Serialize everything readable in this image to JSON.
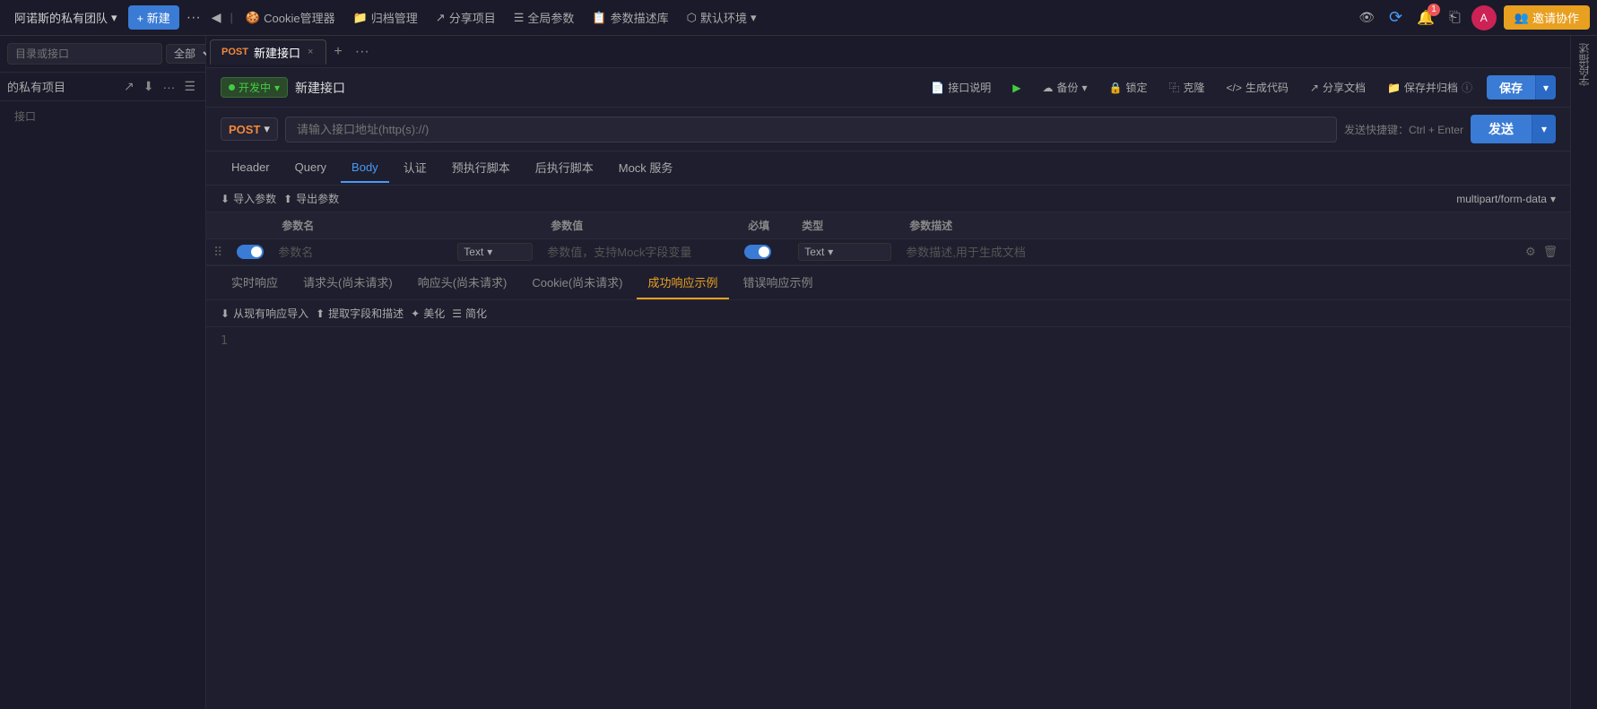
{
  "topNav": {
    "teamName": "阿诺斯的私有团队",
    "newBtn": "+ 新建",
    "moreBtn": "···",
    "prevBtn": "‹",
    "items": [
      {
        "label": "Cookie管理器",
        "icon": "cookie-icon"
      },
      {
        "label": "归档管理",
        "icon": "archive-icon"
      },
      {
        "label": "分享项目",
        "icon": "share-icon"
      },
      {
        "label": "全局参数",
        "icon": "global-param-icon"
      },
      {
        "label": "参数描述库",
        "icon": "param-lib-icon"
      },
      {
        "label": "默认环境",
        "icon": "env-icon",
        "hasArrow": true
      }
    ],
    "eyeBtn": "👁",
    "syncBtn": "⟳",
    "notifCount": "1",
    "historyBtn": "⎗",
    "avatarInitial": "A",
    "inviteBtn": "邀请协作"
  },
  "sidebar": {
    "searchPlaceholder": "目录或接口",
    "filterAll": "全部",
    "myProjects": "的私有项目",
    "emptyInterface": "接口"
  },
  "tabs": [
    {
      "method": "POST",
      "label": "新建接口",
      "active": true
    }
  ],
  "tabActions": {
    "close": "×",
    "add": "+",
    "more": "···"
  },
  "interfaceHeader": {
    "statusLabel": "开发中",
    "statusArrow": "▾",
    "interfaceName": "新建接口",
    "actions": [
      {
        "label": "接口说明",
        "key": "doc"
      },
      {
        "label": "▶",
        "key": "run"
      },
      {
        "label": "备份",
        "key": "backup"
      },
      {
        "label": "锁定",
        "key": "lock"
      },
      {
        "label": "克隆",
        "key": "clone"
      },
      {
        "label": "生成代码",
        "key": "gencode"
      },
      {
        "label": "分享文档",
        "key": "sharedoc"
      },
      {
        "label": "保存并归档",
        "key": "savearchive"
      }
    ],
    "saveBtn": "保存",
    "saveCaret": "▾"
  },
  "urlBar": {
    "method": "POST",
    "methodCaret": "▾",
    "placeholder": "请输入接口地址(http(s)://)",
    "shortcutLabel": "发送快捷键：Ctrl + Enter",
    "sendBtn": "发送",
    "sendCaret": "▾"
  },
  "subTabs": [
    {
      "label": "Header",
      "active": false
    },
    {
      "label": "Query",
      "active": false
    },
    {
      "label": "Body",
      "active": true
    },
    {
      "label": "认证",
      "active": false
    },
    {
      "label": "预执行脚本",
      "active": false
    },
    {
      "label": "后执行脚本",
      "active": false
    },
    {
      "label": "Mock 服务",
      "active": false
    }
  ],
  "paramsToolbar": {
    "importLabel": "导入参数",
    "exportLabel": "导出参数",
    "formType": "multipart/form-data",
    "formTypeCaret": "▾"
  },
  "tableHeaders": [
    {
      "label": "",
      "key": "drag"
    },
    {
      "label": "",
      "key": "toggle"
    },
    {
      "label": "参数名",
      "key": "name"
    },
    {
      "label": "",
      "key": "typeA"
    },
    {
      "label": "参数值",
      "key": "value"
    },
    {
      "label": "必填",
      "key": "required"
    },
    {
      "label": "类型",
      "key": "type"
    },
    {
      "label": "参数描述",
      "key": "desc"
    },
    {
      "label": "",
      "key": "actions"
    }
  ],
  "tableRows": [
    {
      "namePlaceholder": "参数名",
      "typeA": "Text",
      "valuePlaceholder": "参数值，支持Mock字段变量",
      "required": true,
      "typeB": "Text",
      "descPlaceholder": "参数描述,用于生成文档",
      "enabled": true
    }
  ],
  "responseTabs": [
    {
      "label": "实时响应",
      "active": false
    },
    {
      "label": "请求头(尚未请求)",
      "active": false
    },
    {
      "label": "响应头(尚未请求)",
      "active": false
    },
    {
      "label": "Cookie(尚未请求)",
      "active": false
    },
    {
      "label": "成功响应示例",
      "active": true
    },
    {
      "label": "错误响应示例",
      "active": false
    }
  ],
  "responseToolbar": {
    "importLabel": "从现有响应导入",
    "extractLabel": "提取字段和描述",
    "beautifyLabel": "美化",
    "simplifyLabel": "简化"
  },
  "responseBody": {
    "line1": "1",
    "content": ""
  },
  "rightGutter": {
    "label": "字段描述"
  }
}
